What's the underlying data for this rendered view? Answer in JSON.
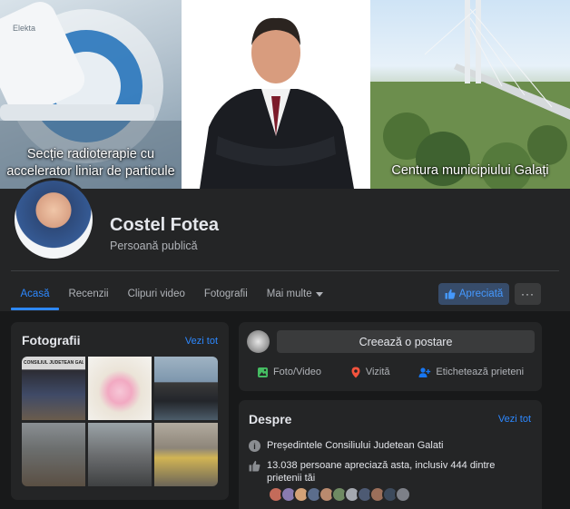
{
  "cover": {
    "left_caption": "Secție radioterapie cu\naccelerator liniar de particule",
    "left_brand": "Elekta",
    "right_caption": "Centura municipiului Galați"
  },
  "profile": {
    "name": "Costel Fotea",
    "category": "Persoană publică"
  },
  "tabs": [
    {
      "label": "Acasă",
      "active": true
    },
    {
      "label": "Recenzii"
    },
    {
      "label": "Clipuri video"
    },
    {
      "label": "Fotografii"
    },
    {
      "label": "Mai multe"
    }
  ],
  "actions": {
    "like_label": "Apreciată",
    "more_label": "···"
  },
  "photos": {
    "title": "Fotografii",
    "see_all": "Vezi tot",
    "sign_text": "CONSILIUL JUDETEAN GALATI"
  },
  "composer": {
    "placeholder": "Creează o postare",
    "actions": [
      {
        "label": "Foto/Video",
        "icon": "photo-video-icon",
        "color": "#45bd62"
      },
      {
        "label": "Vizită",
        "icon": "location-pin-icon",
        "color": "#f5533d"
      },
      {
        "label": "Etichetează prieteni",
        "icon": "tag-friends-icon",
        "color": "#1877f2"
      }
    ]
  },
  "about": {
    "title": "Despre",
    "see_all": "Vezi tot",
    "description": "Președintele Consiliului Judetean Galati",
    "likes": "13.038 persoane apreciază asta, inclusiv 444 dintre prietenii tăi"
  },
  "colors": {
    "background": "#18191a",
    "card": "#242526",
    "accent": "#2d88ff",
    "text_primary": "#e4e6eb",
    "text_secondary": "#b0b3b8"
  }
}
